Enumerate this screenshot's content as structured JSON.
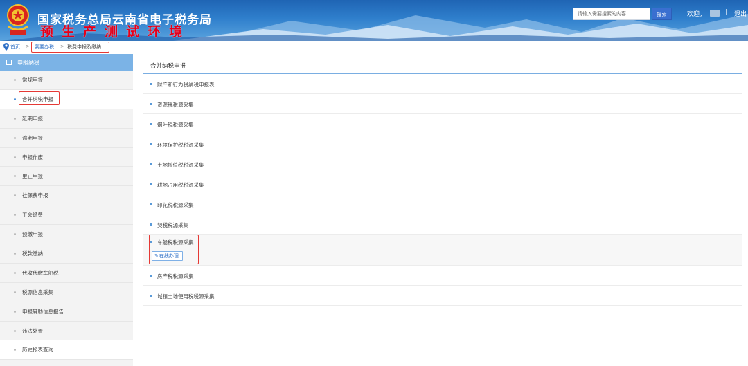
{
  "header": {
    "title": "国家税务总局云南省电子税务局",
    "env_label": "预生产测试环境",
    "search_placeholder": "请输入需要搜索的内容",
    "search_button": "搜索",
    "welcome": "欢迎，",
    "separator": "|",
    "logout": "退出"
  },
  "breadcrumb": {
    "home": "首页",
    "sep": ">",
    "items": [
      "我要办税",
      "税费申报及缴纳"
    ]
  },
  "sidebar": {
    "title": "申报纳税",
    "items": [
      "常规申报",
      "合并纳税申报",
      "延期申报",
      "逾期申报",
      "申报作废",
      "更正申报",
      "社保费申报",
      "工会经费",
      "预缴申报",
      "税款缴纳",
      "代收代缴车船税",
      "税源信息采集",
      "申报辅助信息报告",
      "违法处置",
      "历史报表查询"
    ],
    "active_index": 1
  },
  "main": {
    "title": "合并纳税申报",
    "items": [
      "财产和行为税纳税申报表",
      "资源税税源采集",
      "烟叶税税源采集",
      "环境保护税税源采集",
      "土地增值税税源采集",
      "耕地占用税税源采集",
      "印花税税源采集",
      "契税税源采集",
      "车船税税源采集",
      "房产税税源采集",
      "城镇土地使用税税源采集"
    ],
    "expanded_index": 8,
    "online_button": "在线办理"
  },
  "colors": {
    "header_blue": "#2f7fcc",
    "sidebar_header": "#7bb3e6",
    "highlight_red": "#e53935",
    "link_blue": "#2d6fc6"
  }
}
